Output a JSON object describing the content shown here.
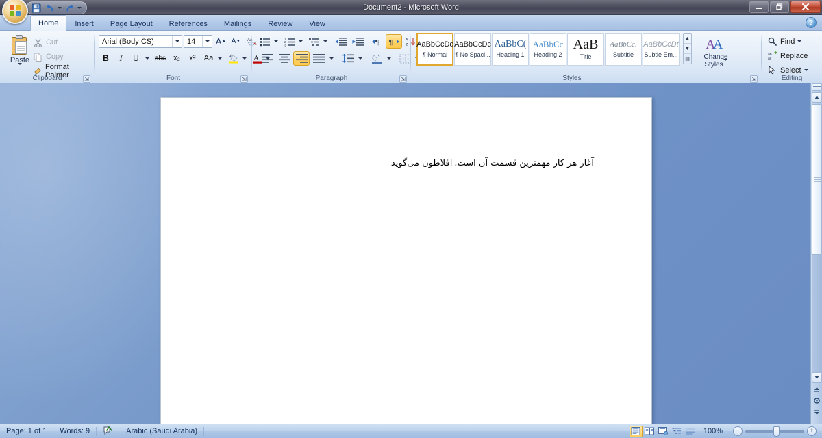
{
  "window": {
    "title": "Document2 - Microsoft Word",
    "minimize_label": "—",
    "restore_label": "❐",
    "close_label": "✕",
    "help_label": "?"
  },
  "quick_access": [
    {
      "name": "save-button",
      "glyph": "💾",
      "label": "Save"
    },
    {
      "name": "undo-button",
      "glyph": "↶",
      "label": "Undo"
    },
    {
      "name": "redo-button",
      "glyph": "↷",
      "label": "Redo"
    },
    {
      "name": "customize-qat-button",
      "glyph": "▾",
      "label": "Customize Quick Access Toolbar"
    }
  ],
  "office_button": {
    "label": "Office Button"
  },
  "tabs": [
    {
      "label": "Home",
      "active": true
    },
    {
      "label": "Insert",
      "active": false
    },
    {
      "label": "Page Layout",
      "active": false
    },
    {
      "label": "References",
      "active": false
    },
    {
      "label": "Mailings",
      "active": false
    },
    {
      "label": "Review",
      "active": false
    },
    {
      "label": "View",
      "active": false
    }
  ],
  "ribbon": {
    "clipboard": {
      "group_label": "Clipboard",
      "paste_label": "Paste",
      "cut_label": "Cut",
      "copy_label": "Copy",
      "format_painter_label": "Format Painter",
      "dialog_launcher": "⇲"
    },
    "font": {
      "group_label": "Font",
      "font_name": "Arial (Body CS)",
      "font_size": "14",
      "grow_font_label": "A",
      "shrink_font_label": "A",
      "clear_formatting_label": "Aa",
      "bold_label": "B",
      "italic_label": "I",
      "underline_label": "U",
      "strikethrough_label": "abc",
      "subscript_label": "x₂",
      "superscript_label": "x²",
      "change_case_label": "Aa",
      "highlight_label": "ab",
      "font_color_label": "A",
      "dialog_launcher": "⇲"
    },
    "paragraph": {
      "group_label": "Paragraph",
      "bullets_label": "•≡",
      "numbering_label": "1≡",
      "multilevel_label": "≡",
      "decrease_indent_label": "⇤",
      "increase_indent_label": "⇥",
      "ltr_label": "¶→",
      "rtl_label": "←¶",
      "rtl_active": true,
      "sort_label": "A↓",
      "show_marks_label": "¶",
      "align_left_label": "≡",
      "align_center_label": "≡",
      "align_right_label": "≡",
      "align_right_active": true,
      "justify_label": "≡",
      "line_spacing_label": "↕≡",
      "shading_label": "▨",
      "borders_label": "⊞",
      "dialog_launcher": "⇲"
    },
    "styles": {
      "group_label": "Styles",
      "items": [
        {
          "preview": "AaBbCcDc",
          "name": "¶ Normal",
          "selected": true
        },
        {
          "preview": "AaBbCcDc",
          "name": "¶ No Spaci...",
          "selected": false
        },
        {
          "preview": "AaBbC(",
          "name": "Heading 1",
          "selected": false
        },
        {
          "preview": "AaBbCc",
          "name": "Heading 2",
          "selected": false
        },
        {
          "preview": "AaB",
          "name": "Title",
          "selected": false
        },
        {
          "preview": "AaBbCc.",
          "name": "Subtitle",
          "selected": false
        },
        {
          "preview": "AaBbCcDt",
          "name": "Subtle Em...",
          "selected": false
        }
      ],
      "nav_up": "▲",
      "nav_down": "▼",
      "nav_more": "▤",
      "change_styles_label_line1": "Change",
      "change_styles_label_line2": "Styles",
      "dialog_launcher": "⇲"
    },
    "editing": {
      "group_label": "Editing",
      "find_label": "Find",
      "replace_label": "Replace",
      "select_label": "Select"
    }
  },
  "document": {
    "text_before_caret": "افلاطون می‌گوید",
    "text_after_caret": "آغاز هر کار مهمترین قسمت آن است.",
    "full_text": "افلاطون می‌گوید آغاز هر کار مهمترین قسمت آن است.",
    "direction": "rtl"
  },
  "scrollbar": {
    "up_arrow": "▲",
    "down_arrow": "▼",
    "split_handle": "▬",
    "prev_page": "⏶",
    "select_browse_object": "◉",
    "next_page": "⏷"
  },
  "status_bar": {
    "page": "Page: 1 of 1",
    "words": "Words: 9",
    "proofing_icon": "proofing-errors-icon",
    "language": "Arabic (Saudi Arabia)",
    "views": [
      {
        "name": "print-layout-view",
        "glyph": "▤",
        "active": true
      },
      {
        "name": "full-screen-reading-view",
        "glyph": "▥",
        "active": false
      },
      {
        "name": "web-layout-view",
        "glyph": "▦",
        "active": false
      },
      {
        "name": "outline-view",
        "glyph": "▧",
        "active": false
      },
      {
        "name": "draft-view",
        "glyph": "▨",
        "active": false
      }
    ],
    "zoom_level": "100%",
    "zoom_out_label": "−",
    "zoom_in_label": "+"
  },
  "colors": {
    "accent": "#ffcf60",
    "workspace_blue": "#6e91c6",
    "titlebar": "#4e4f5e",
    "ribbon_bg": "#e6eef8",
    "close_red": "#c5543c"
  }
}
